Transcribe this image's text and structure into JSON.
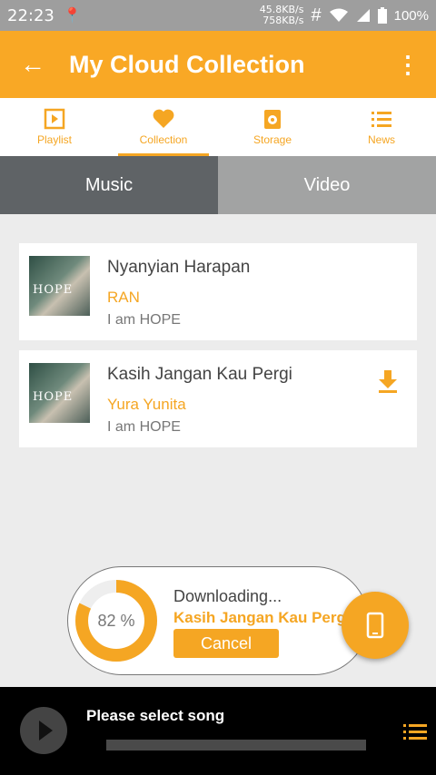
{
  "status": {
    "time": "22:23",
    "net_up": "45.8KB/s",
    "net_down": "758KB/s",
    "hash": "#",
    "battery": "100%"
  },
  "appbar": {
    "title": "My Cloud Collection"
  },
  "tabs": [
    {
      "label": "Playlist",
      "icon": "playlist-icon"
    },
    {
      "label": "Collection",
      "icon": "heart-icon"
    },
    {
      "label": "Storage",
      "icon": "storage-icon"
    },
    {
      "label": "News",
      "icon": "news-icon"
    }
  ],
  "segment": {
    "music": "Music",
    "video": "Video"
  },
  "songs": [
    {
      "title": "Nyanyian Harapan",
      "artist": "RAN",
      "album": "I am HOPE",
      "art_text": "HOPE"
    },
    {
      "title": "Kasih Jangan Kau Pergi",
      "artist": "Yura Yunita",
      "album": "I am HOPE",
      "art_text": "HOPE"
    }
  ],
  "download": {
    "percent": 82,
    "percent_label": "82 %",
    "title": "Downloading...",
    "song": "Kasih Jangan Kau Pergi",
    "cancel": "Cancel"
  },
  "player": {
    "label": "Please select song"
  },
  "colors": {
    "accent": "#f5a623",
    "appbar": "#f9a825",
    "segment_active": "#5f6366",
    "segment_inactive": "#a2a3a3"
  }
}
